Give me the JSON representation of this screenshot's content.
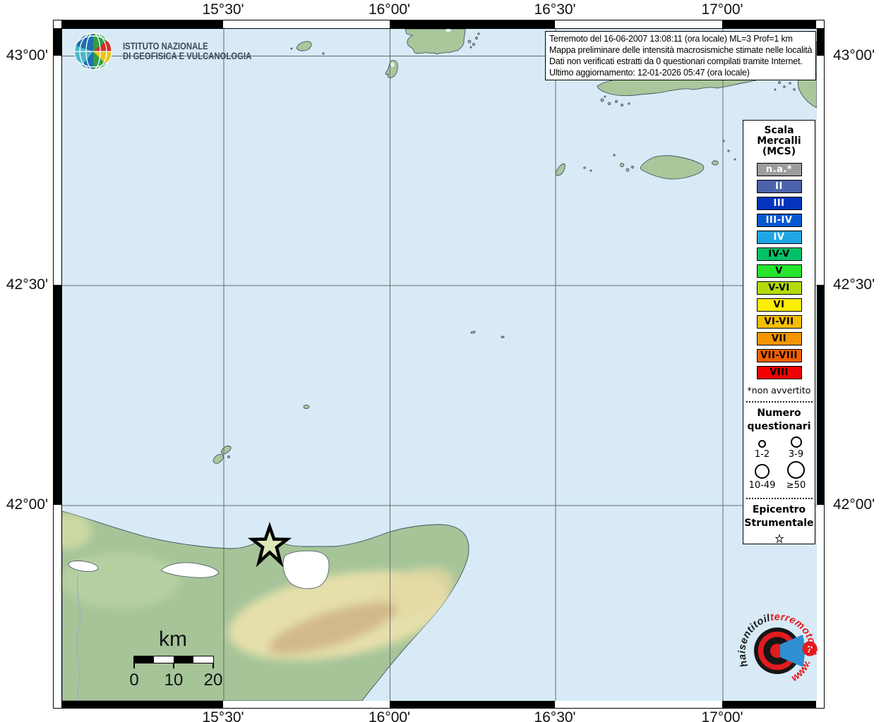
{
  "info_box": {
    "lines": [
      "Terremoto del 16-06-2007 13:08:11 (ora locale) ML=3 Prof=1 km",
      "Mappa preliminare delle intensità macrosismiche stimate nelle località",
      "Dati non verificati estratti da 0 questionari compilati tramite Internet.",
      "Ultimo aggiornamento: 12-01-2026 05:47 (ora locale)"
    ]
  },
  "ingv": {
    "line1": "ISTITUTO NAZIONALE",
    "line2": "DI GEOFISICA E VULCANOLOGIA"
  },
  "axes": {
    "top": [
      "15°30'",
      "16°00'",
      "16°30'",
      "17°00'"
    ],
    "bottom": [
      "15°30'",
      "16°00'",
      "16°30'",
      "17°00'"
    ],
    "left": [
      "43°00'",
      "42°30'",
      "42°00'"
    ],
    "right": [
      "43°00'",
      "42°30'",
      "42°00'"
    ]
  },
  "legend": {
    "title_lines": [
      "Scala",
      "Mercalli",
      "(MCS)"
    ],
    "mercalli": [
      {
        "label": "n.a.*",
        "color": "#9d9d9d",
        "text": "#ffffff"
      },
      {
        "label": "II",
        "color": "#4c63ab",
        "text": "#ffffff"
      },
      {
        "label": "III",
        "color": "#0434bd",
        "text": "#ffffff"
      },
      {
        "label": "III-IV",
        "color": "#0958d2",
        "text": "#ffffff"
      },
      {
        "label": "IV",
        "color": "#21a6e5",
        "text": "#ffffff"
      },
      {
        "label": "IV-V",
        "color": "#00c165",
        "text": "#000000"
      },
      {
        "label": "V",
        "color": "#26e52c",
        "text": "#000000"
      },
      {
        "label": "V-VI",
        "color": "#b3db09",
        "text": "#000000"
      },
      {
        "label": "VI",
        "color": "#fdec03",
        "text": "#000000"
      },
      {
        "label": "VI-VII",
        "color": "#f3bd01",
        "text": "#000000"
      },
      {
        "label": "VII",
        "color": "#f29501",
        "text": "#000000"
      },
      {
        "label": "VII-VIII",
        "color": "#f05f00",
        "text": "#000000"
      },
      {
        "label": "VIII",
        "color": "#f20000",
        "text": "#000000"
      }
    ],
    "footnote": "*non avvertito",
    "questionnaires": {
      "title_lines": [
        "Numero",
        "questionari"
      ],
      "labels": [
        "1-2",
        "3-9",
        "10-49",
        "≥50"
      ]
    },
    "epicenter": {
      "title_lines": [
        "Epicentro",
        "Strumentale"
      ]
    }
  },
  "scalebar": {
    "unit": "km",
    "ticks": [
      "0",
      "10",
      "20"
    ]
  },
  "watermark": {
    "text_black": "haisentitoil",
    "text_red": "terremoto.it",
    "text_www": "www.",
    "question_mark": "?"
  },
  "colors": {
    "sea": "#d7eaf6",
    "land": "#a5c498",
    "grid": "#6a6a6a",
    "coast": "#44525f",
    "star_fill": "#dde7b8",
    "lagoon": "#ffffff"
  }
}
